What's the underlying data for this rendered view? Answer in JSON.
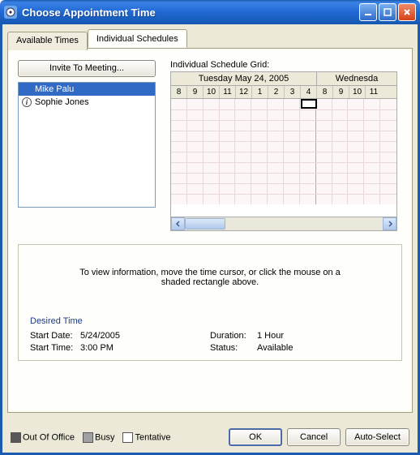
{
  "window": {
    "title": "Choose Appointment Time"
  },
  "tabs": {
    "available": "Available Times",
    "individual": "Individual Schedules"
  },
  "invite_button": "Invite To Meeting...",
  "attendees": [
    {
      "name": "Mike Palu",
      "selected": true,
      "icon": null
    },
    {
      "name": "Sophie Jones",
      "selected": false,
      "icon": "info"
    }
  ],
  "grid": {
    "label": "Individual Schedule Grid:",
    "days": [
      {
        "label": "Tuesday May 24, 2005",
        "span": 9
      },
      {
        "label": "Wednesda",
        "span": 5
      }
    ],
    "hours": [
      "8",
      "9",
      "10",
      "11",
      "12",
      "1",
      "2",
      "3",
      "4",
      "8",
      "9",
      "10",
      "11"
    ]
  },
  "info_message": "To view information, move the time cursor, or click the mouse on a shaded rectangle above.",
  "desired": {
    "title": "Desired Time",
    "start_date_label": "Start Date:",
    "start_date": "5/24/2005",
    "start_time_label": "Start Time:",
    "start_time": "3:00 PM",
    "duration_label": "Duration:",
    "duration": "1 Hour",
    "status_label": "Status:",
    "status": "Available"
  },
  "legend": {
    "out": "Out Of Office",
    "busy": "Busy",
    "tentative": "Tentative"
  },
  "buttons": {
    "ok": "OK",
    "cancel": "Cancel",
    "auto": "Auto-Select"
  }
}
